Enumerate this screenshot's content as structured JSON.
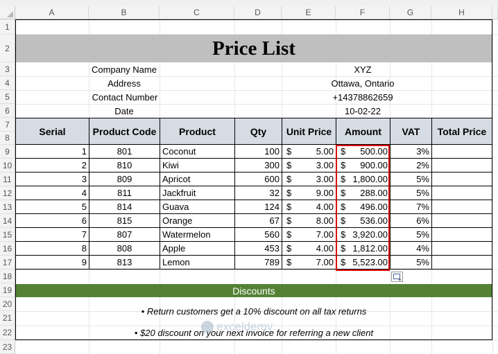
{
  "columns": [
    "A",
    "B",
    "C",
    "D",
    "E",
    "F",
    "G",
    "H"
  ],
  "rows": [
    "1",
    "2",
    "3",
    "4",
    "5",
    "6",
    "7",
    "8",
    "9",
    "10",
    "11",
    "12",
    "13",
    "14",
    "15",
    "16",
    "17",
    "18",
    "19",
    "20",
    "21",
    "22",
    "23"
  ],
  "title": "Price List",
  "info": {
    "company_label": "Company Name",
    "company_value": "XYZ",
    "address_label": "Address",
    "address_value": "Ottawa, Ontario",
    "contact_label": "Contact Number",
    "contact_value": "+14378862659",
    "date_label": "Date",
    "date_value": "10-02-22"
  },
  "table": {
    "headers": [
      "Serial",
      "Product Code",
      "Product",
      "Qty",
      "Unit Price",
      "Amount",
      "VAT",
      "Total Price"
    ],
    "currency_symbol": "$",
    "rows": [
      {
        "serial": "1",
        "code": "801",
        "product": "Coconut",
        "qty": "100",
        "unit_price": "5.00",
        "amount": "500.00",
        "vat": "3%",
        "total": ""
      },
      {
        "serial": "2",
        "code": "810",
        "product": "Kiwi",
        "qty": "300",
        "unit_price": "3.00",
        "amount": "900.00",
        "vat": "2%",
        "total": ""
      },
      {
        "serial": "3",
        "code": "809",
        "product": "Apricot",
        "qty": "600",
        "unit_price": "3.00",
        "amount": "1,800.00",
        "vat": "5%",
        "total": ""
      },
      {
        "serial": "4",
        "code": "811",
        "product": "Jackfruit",
        "qty": "32",
        "unit_price": "9.00",
        "amount": "288.00",
        "vat": "5%",
        "total": ""
      },
      {
        "serial": "5",
        "code": "814",
        "product": "Guava",
        "qty": "124",
        "unit_price": "4.00",
        "amount": "496.00",
        "vat": "7%",
        "total": ""
      },
      {
        "serial": "6",
        "code": "815",
        "product": "Orange",
        "qty": "67",
        "unit_price": "8.00",
        "amount": "536.00",
        "vat": "6%",
        "total": ""
      },
      {
        "serial": "7",
        "code": "807",
        "product": "Watermelon",
        "qty": "560",
        "unit_price": "7.00",
        "amount": "3,920.00",
        "vat": "5%",
        "total": ""
      },
      {
        "serial": "8",
        "code": "808",
        "product": "Apple",
        "qty": "453",
        "unit_price": "4.00",
        "amount": "1,812.00",
        "vat": "4%",
        "total": ""
      },
      {
        "serial": "9",
        "code": "813",
        "product": "Lemon",
        "qty": "789",
        "unit_price": "7.00",
        "amount": "5,523.00",
        "vat": "5%",
        "total": ""
      }
    ]
  },
  "discounts": {
    "title": "Discounts",
    "note1": "• Return customers get a 10% discount on all tax returns",
    "note2": "• $20 discount on your next invoice for referring a new client"
  },
  "watermark": "exceldemy",
  "colors": {
    "title_bg": "#bfbfbf",
    "header_bg": "#d6dce4",
    "discount_bg": "#548235",
    "selection": "#e00000"
  }
}
